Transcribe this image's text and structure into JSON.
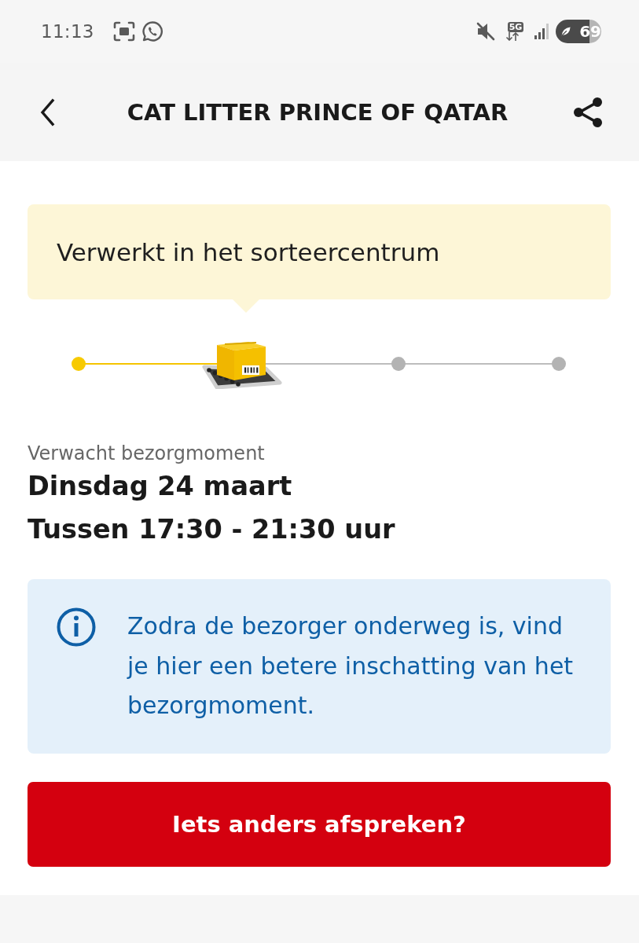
{
  "status_bar": {
    "time": "11:13",
    "network": "5G",
    "battery": "69"
  },
  "header": {
    "title": "CAT LITTER PRINCE OF QATAR"
  },
  "status_callout": {
    "text": "Verwerkt in het sorteercentrum"
  },
  "progress": {
    "steps": [
      {
        "kind": "done"
      },
      {
        "kind": "current"
      },
      {
        "kind": "pending"
      },
      {
        "kind": "pending"
      }
    ]
  },
  "delivery": {
    "label": "Verwacht bezorgmoment",
    "date": "Dinsdag 24 maart",
    "time_window": "Tussen 17:30 - 21:30 uur"
  },
  "info": {
    "text": "Zodra de bezorger onderweg is, vind je hier een betere inschatting van het bezorgmoment."
  },
  "action_button": {
    "label": "Iets anders afspreken?"
  }
}
